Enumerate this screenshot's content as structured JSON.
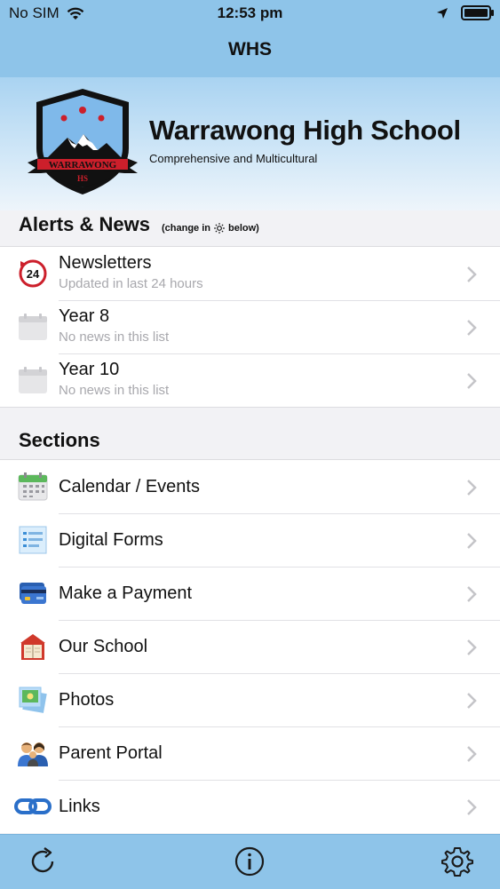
{
  "status": {
    "carrier": "No SIM",
    "time": "12:53 pm"
  },
  "nav": {
    "title": "WHS"
  },
  "school": {
    "name": "Warrawong High School",
    "subtitle": "Comprehensive and Multicultural",
    "logo_text": "WARRAWONG",
    "logo_initials": "HS"
  },
  "alerts": {
    "heading": "Alerts & News",
    "note_before": "(change in",
    "note_after": "below)",
    "items": [
      {
        "title": "Newsletters",
        "subtitle": "Updated in last 24 hours",
        "icon": "24-hour-icon",
        "badge": "24"
      },
      {
        "title": "Year 8",
        "subtitle": "No news in this list",
        "icon": "calendar-empty-icon"
      },
      {
        "title": "Year 10",
        "subtitle": "No news in this list",
        "icon": "calendar-empty-icon"
      }
    ]
  },
  "sections": {
    "heading": "Sections",
    "items": [
      {
        "label": "Calendar / Events",
        "icon": "calendar-icon"
      },
      {
        "label": "Digital Forms",
        "icon": "form-icon"
      },
      {
        "label": "Make a Payment",
        "icon": "credit-card-icon"
      },
      {
        "label": "Our School",
        "icon": "school-book-icon"
      },
      {
        "label": "Photos",
        "icon": "photos-icon"
      },
      {
        "label": "Parent Portal",
        "icon": "parents-icon"
      },
      {
        "label": "Links",
        "icon": "link-icon"
      }
    ]
  },
  "tabbar": {
    "items": [
      "refresh-icon",
      "info-icon",
      "settings-icon"
    ]
  },
  "colors": {
    "bar": "#8ec4e9",
    "accent_red": "#cc1f2b",
    "logo_blue": "#7fb9ea"
  }
}
